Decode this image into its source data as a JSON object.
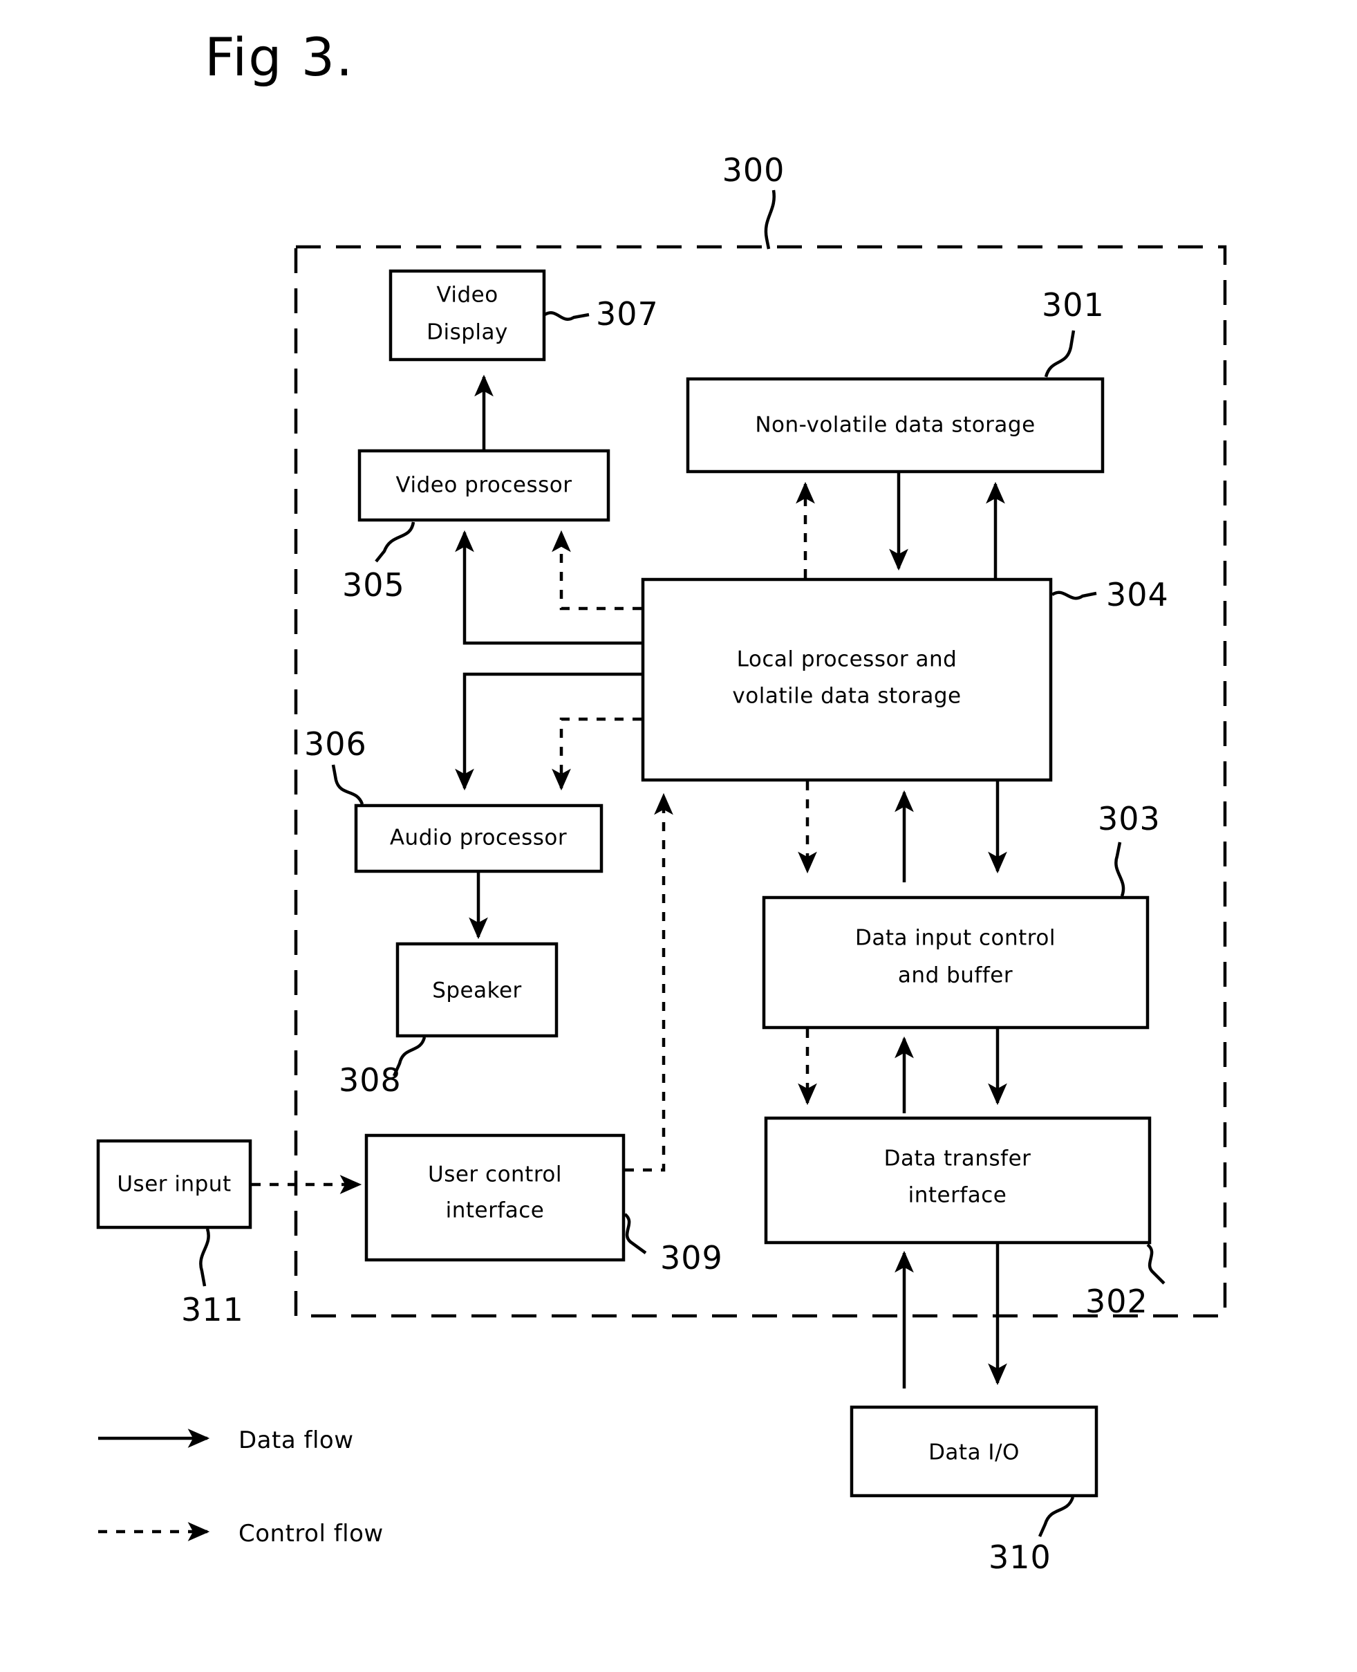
{
  "figure": {
    "title": "Fig 3.",
    "system_ref": "300"
  },
  "blocks": [
    {
      "id": "video_display",
      "label_line1": "Video",
      "label_line2": "Display",
      "ref": "307"
    },
    {
      "id": "video_processor",
      "label_line1": "Video processor",
      "label_line2": "",
      "ref": "305"
    },
    {
      "id": "nv_storage",
      "label_line1": "Non-volatile data storage",
      "label_line2": "",
      "ref": "301"
    },
    {
      "id": "local_processor",
      "label_line1": "Local processor and",
      "label_line2": "volatile data storage",
      "ref": "304"
    },
    {
      "id": "audio_processor",
      "label_line1": "Audio processor",
      "label_line2": "",
      "ref": "306"
    },
    {
      "id": "speaker",
      "label_line1": "Speaker",
      "label_line2": "",
      "ref": "308"
    },
    {
      "id": "user_input",
      "label_line1": "User input",
      "label_line2": "",
      "ref": "311"
    },
    {
      "id": "user_control",
      "label_line1": "User control",
      "label_line2": "interface",
      "ref": "309"
    },
    {
      "id": "data_input",
      "label_line1": "Data input control",
      "label_line2": "and buffer",
      "ref": "303"
    },
    {
      "id": "data_transfer",
      "label_line1": "Data transfer",
      "label_line2": "interface",
      "ref": "302"
    },
    {
      "id": "data_io",
      "label_line1": "Data I/O",
      "label_line2": "",
      "ref": "310"
    }
  ],
  "legend": {
    "data_flow": "Data flow",
    "control_flow": "Control flow"
  },
  "colors": {
    "ink": "#000000",
    "paper": "#ffffff"
  }
}
